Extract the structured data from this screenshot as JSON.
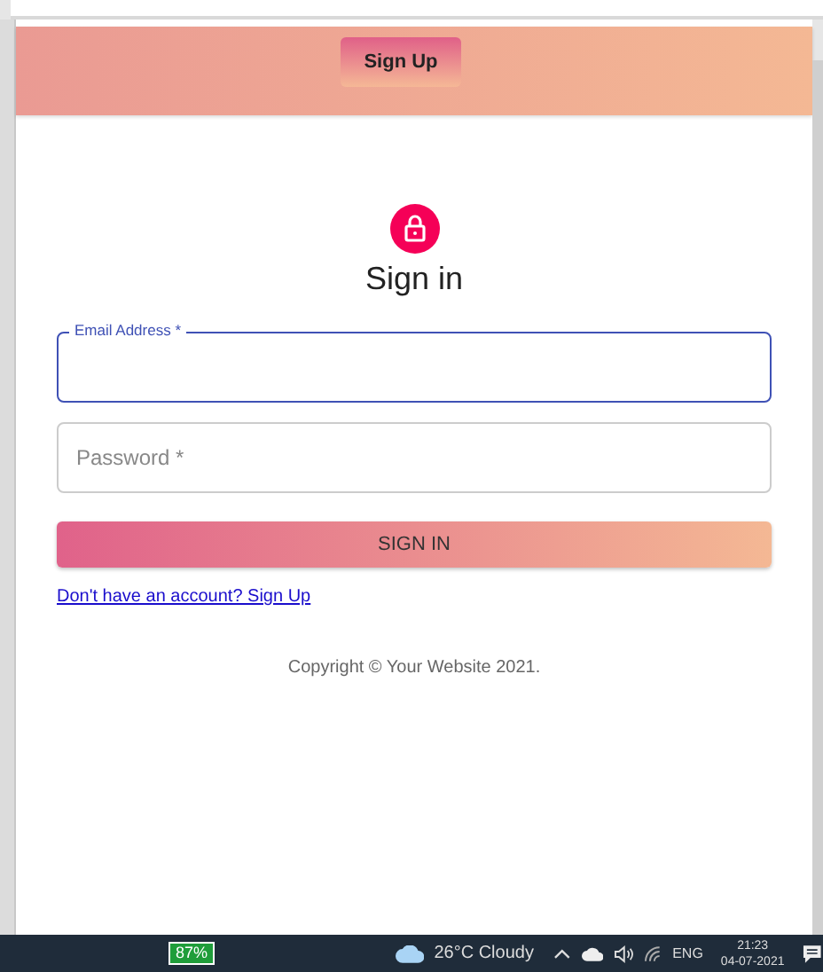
{
  "header": {
    "button": "Sign Up"
  },
  "form": {
    "title": "Sign in",
    "fields": [
      {
        "label": "Email Address *",
        "focused": true
      },
      {
        "label": "Password *",
        "focused": false
      }
    ],
    "submit": "SIGN IN",
    "link": "Don't have an account? Sign Up",
    "copyright": "Copyright © Your Website 2021."
  },
  "taskbar": {
    "battery": "87%",
    "weather": "26°C  Cloudy",
    "language": "ENG",
    "time": "21:23",
    "date": "04-07-2021"
  }
}
